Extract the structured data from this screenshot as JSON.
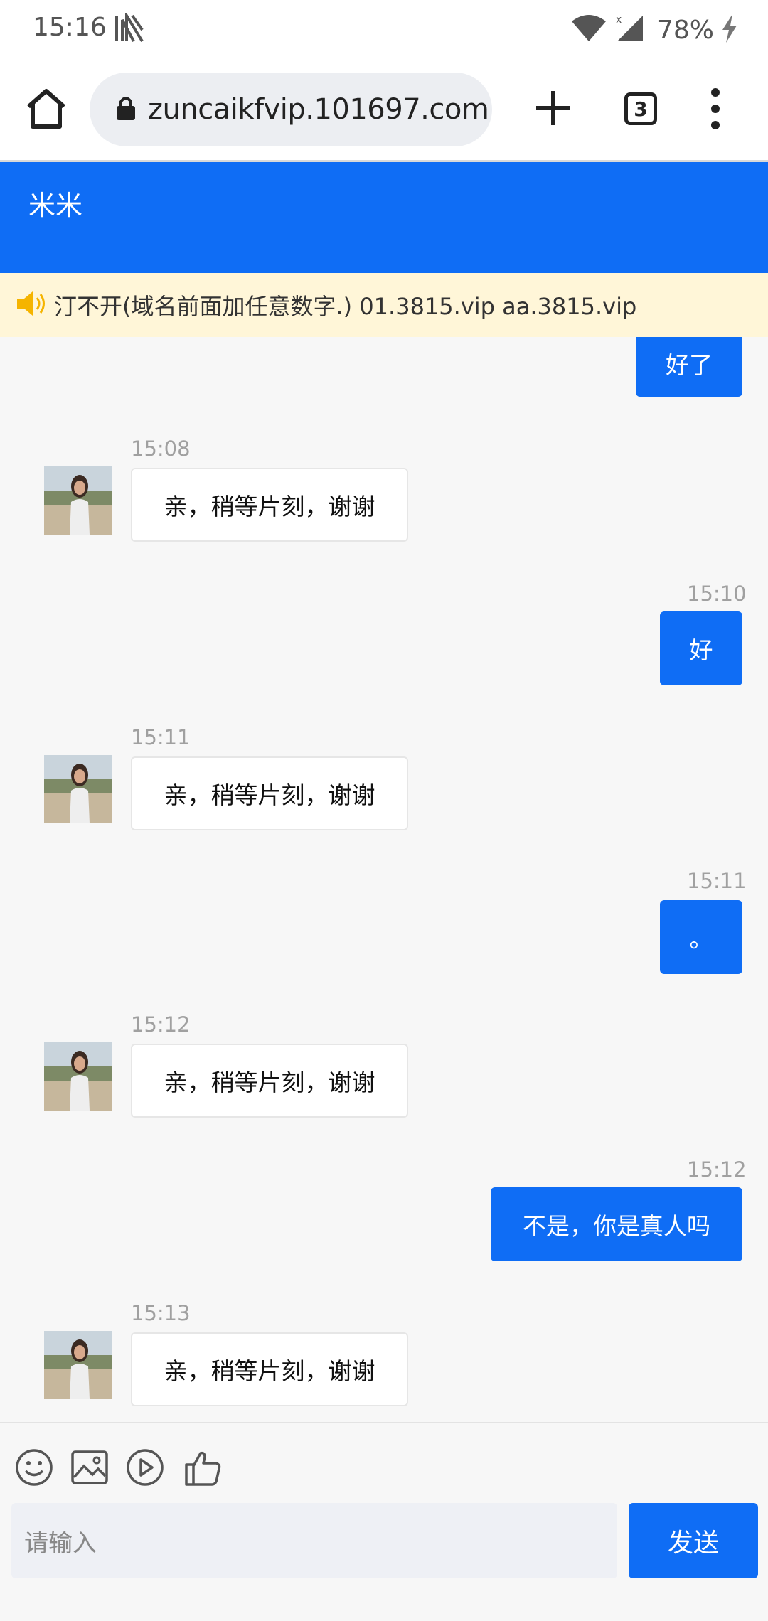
{
  "status_bar": {
    "time": "15:16",
    "battery": "78%"
  },
  "browser": {
    "url": "zuncaikfvip.101697.com",
    "tab_count": "3"
  },
  "chat": {
    "title": "米米",
    "notice": "汀不开(域名前面加任意数字.) 01.3815.vip aa.3815.vip",
    "messages": [
      {
        "side": "out",
        "text": "好了"
      },
      {
        "side": "in",
        "time": "15:08",
        "text": "亲，稍等片刻，谢谢"
      },
      {
        "side": "out",
        "time": "15:10",
        "text": "好"
      },
      {
        "side": "in",
        "time": "15:11",
        "text": "亲，稍等片刻，谢谢"
      },
      {
        "side": "out",
        "time": "15:11",
        "text": "。"
      },
      {
        "side": "in",
        "time": "15:12",
        "text": "亲，稍等片刻，谢谢"
      },
      {
        "side": "out",
        "time": "15:12",
        "text": "不是，你是真人吗"
      },
      {
        "side": "in",
        "time": "15:13",
        "text": "亲，稍等片刻，谢谢"
      }
    ]
  },
  "composer": {
    "tools": [
      "emoji-icon",
      "image-icon",
      "video-icon",
      "thumbs-up-icon"
    ],
    "placeholder": "请输入",
    "send_label": "发送"
  },
  "colors": {
    "accent": "#0f6df5",
    "notice_bg": "#fff6d8",
    "speaker": "#f5b400"
  }
}
